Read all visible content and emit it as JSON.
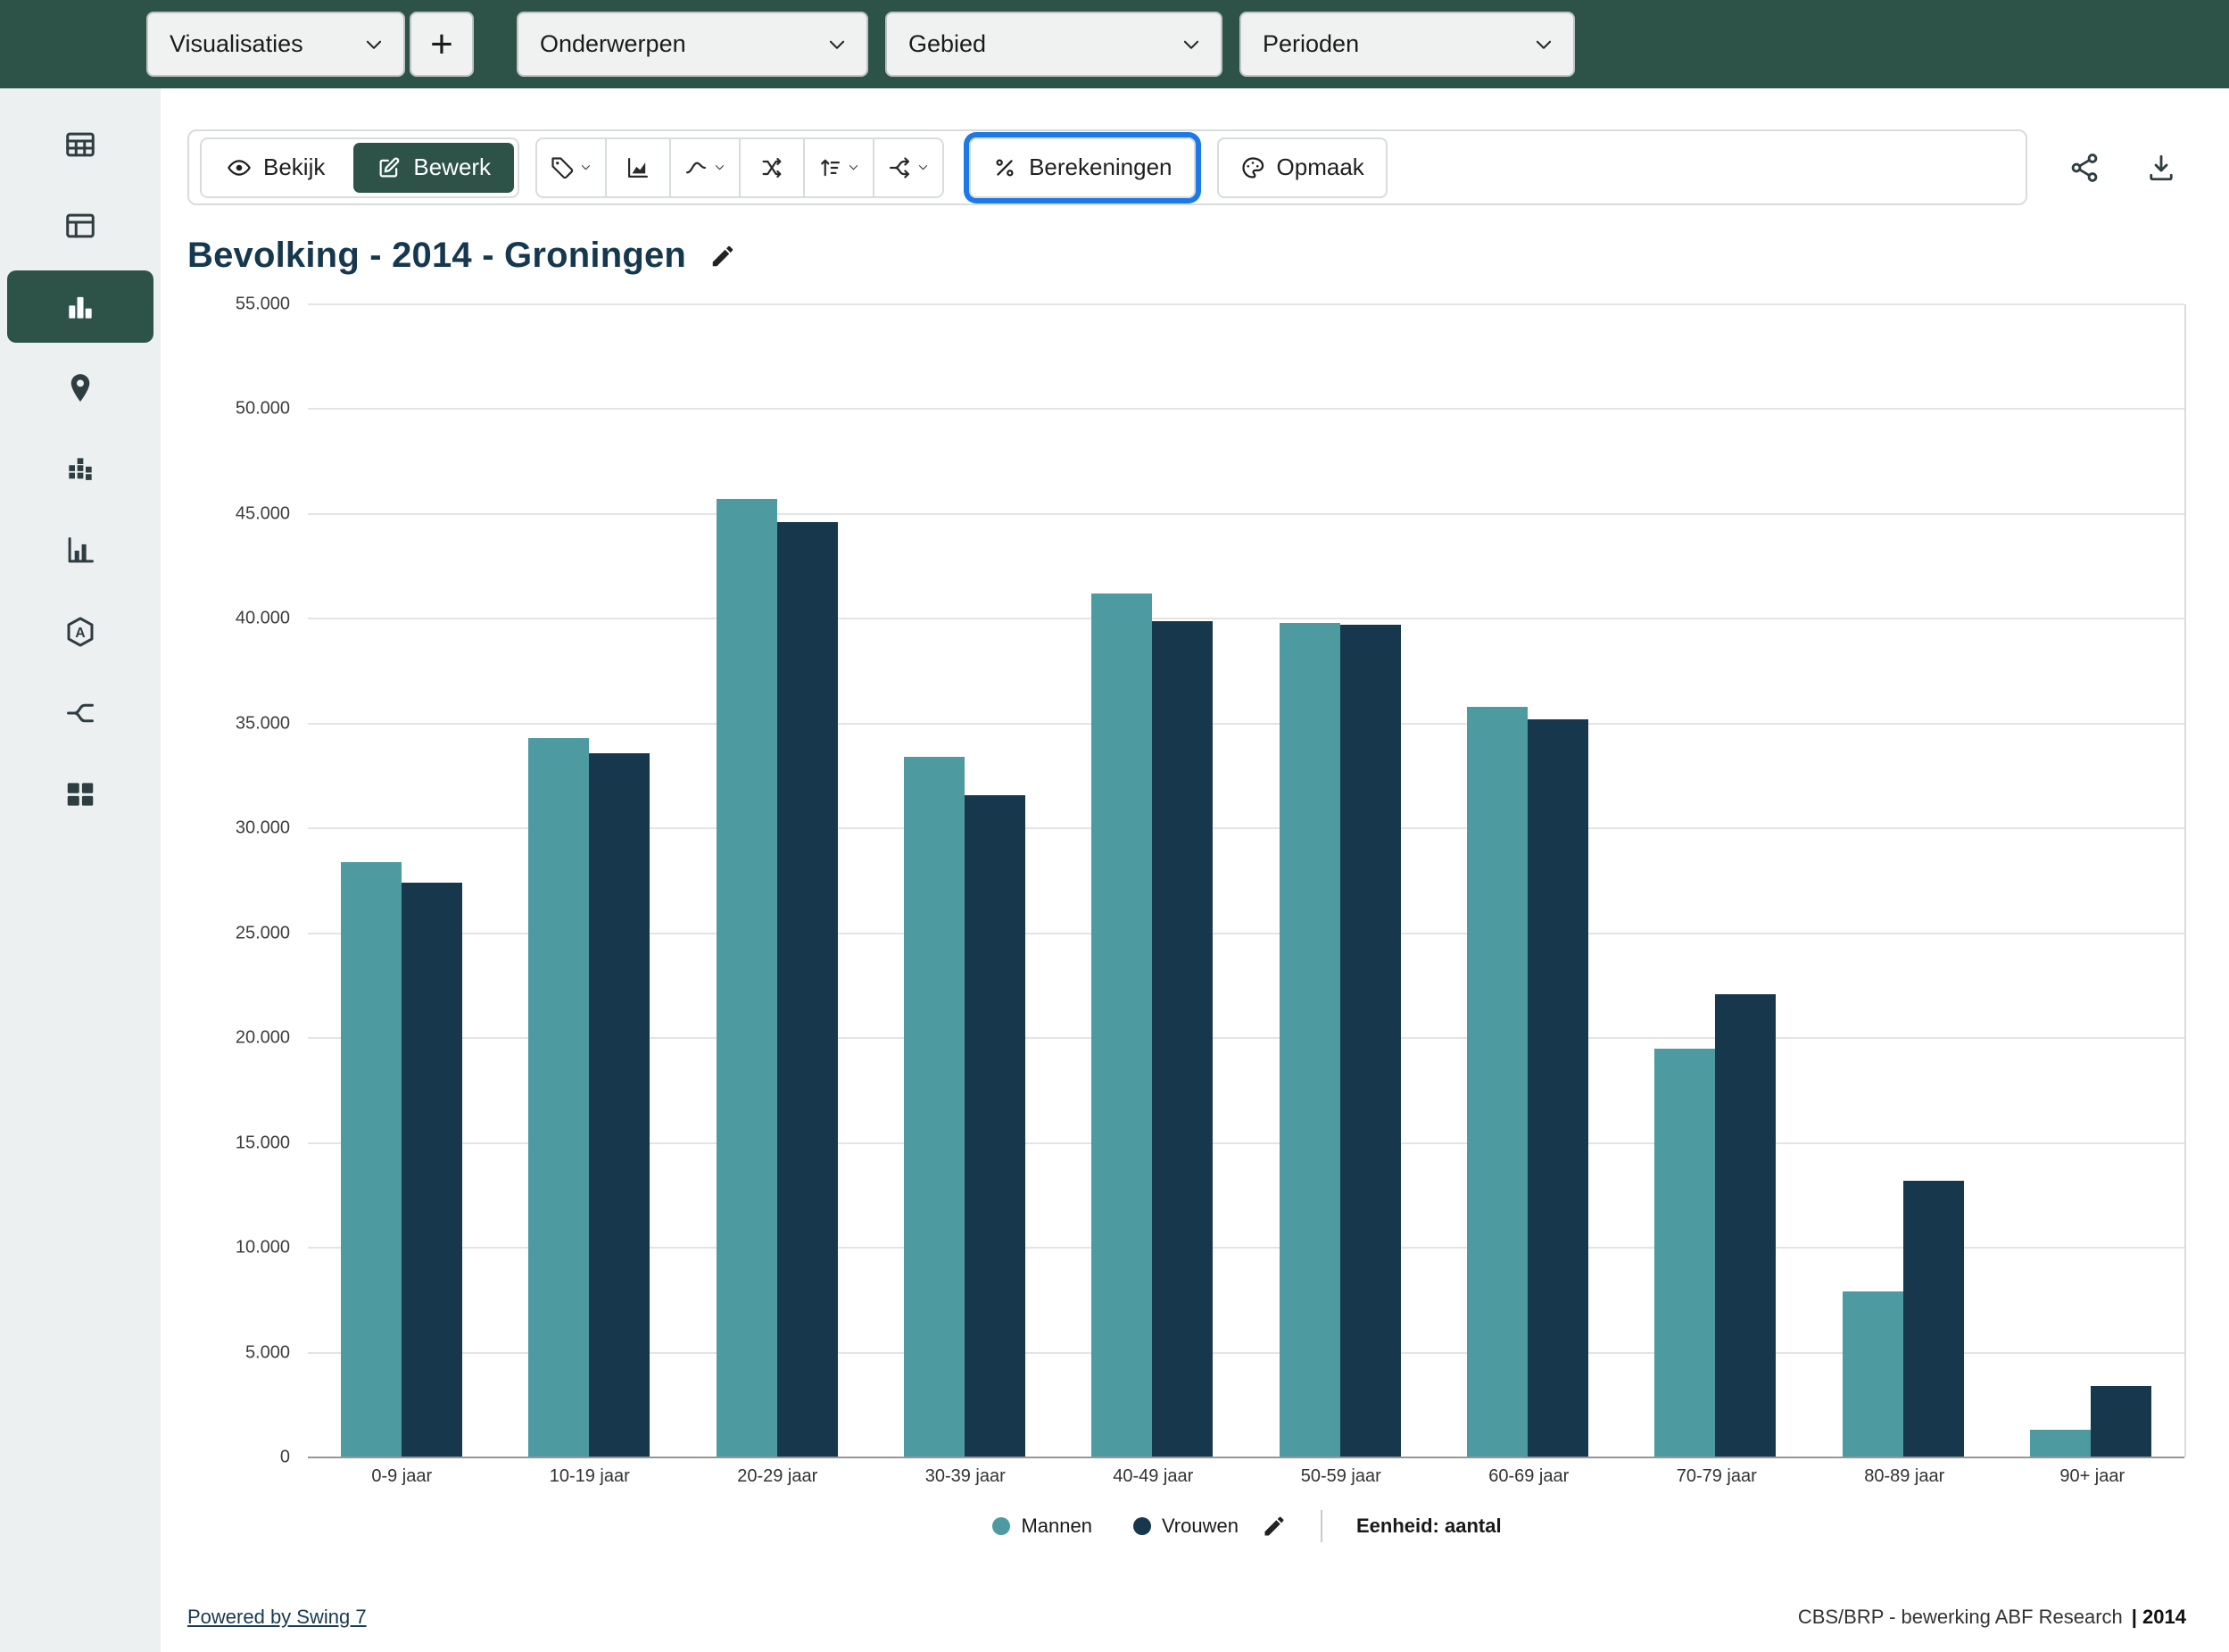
{
  "colors": {
    "accent_green": "#2d5349",
    "highlight_blue": "#1e79e8",
    "bar_mannen": "#4d9aa0",
    "bar_vrouwen": "#17384c",
    "sidebar_bg": "#edf0f0"
  },
  "topbar": {
    "dropdowns": [
      {
        "label": "Visualisaties"
      },
      {
        "label": "Onderwerpen"
      },
      {
        "label": "Gebied"
      },
      {
        "label": "Perioden"
      }
    ],
    "add_button": "+"
  },
  "sidebar": {
    "items": [
      {
        "icon": "table-icon",
        "active": false
      },
      {
        "icon": "pivot-table-icon",
        "active": false
      },
      {
        "icon": "bar-chart-icon",
        "active": true
      },
      {
        "icon": "map-pin-icon",
        "active": false
      },
      {
        "icon": "block-chart-icon",
        "active": false
      },
      {
        "icon": "axis-chart-icon",
        "active": false
      },
      {
        "icon": "hexagon-marker-icon",
        "active": false
      },
      {
        "icon": "flow-icon",
        "active": false
      },
      {
        "icon": "dashboard-icon",
        "active": false
      }
    ]
  },
  "toolbar": {
    "view_label": "Bekijk",
    "edit_label": "Bewerk",
    "icon_buttons": [
      {
        "icon": "tag-icon",
        "chevron": true
      },
      {
        "icon": "area-chart-icon",
        "chevron": false
      },
      {
        "icon": "line-style-icon",
        "chevron": true
      },
      {
        "icon": "swap-icon",
        "chevron": false
      },
      {
        "icon": "sort-icon",
        "chevron": true
      },
      {
        "icon": "split-icon",
        "chevron": true
      }
    ],
    "calculations_label": "Berekeningen",
    "format_label": "Opmaak"
  },
  "header_actions": [
    {
      "icon": "share-icon"
    },
    {
      "icon": "download-icon"
    }
  ],
  "title": "Bevolking - 2014 - Groningen",
  "chart_data": {
    "type": "bar",
    "title": "Bevolking - 2014 - Groningen",
    "categories": [
      "0-9 jaar",
      "10-19 jaar",
      "20-29 jaar",
      "30-39 jaar",
      "40-49 jaar",
      "50-59 jaar",
      "60-69 jaar",
      "70-79 jaar",
      "80-89 jaar",
      "90+ jaar"
    ],
    "series": [
      {
        "name": "Mannen",
        "color": "#4d9aa0",
        "values": [
          28400,
          34300,
          45700,
          33400,
          41200,
          39800,
          35800,
          19500,
          7900,
          1300
        ]
      },
      {
        "name": "Vrouwen",
        "color": "#17384c",
        "values": [
          27400,
          33600,
          44600,
          31600,
          39900,
          39700,
          35200,
          22100,
          13200,
          3400
        ]
      }
    ],
    "ylim": [
      0,
      55000
    ],
    "ytick_step": 5000,
    "grid": true,
    "legend_position": "bottom",
    "unit_label": "Eenheid: aantal"
  },
  "footer": {
    "left_link": "Powered by Swing 7",
    "right_text": "CBS/BRP - bewerking ABF Research",
    "right_year": "| 2014"
  }
}
